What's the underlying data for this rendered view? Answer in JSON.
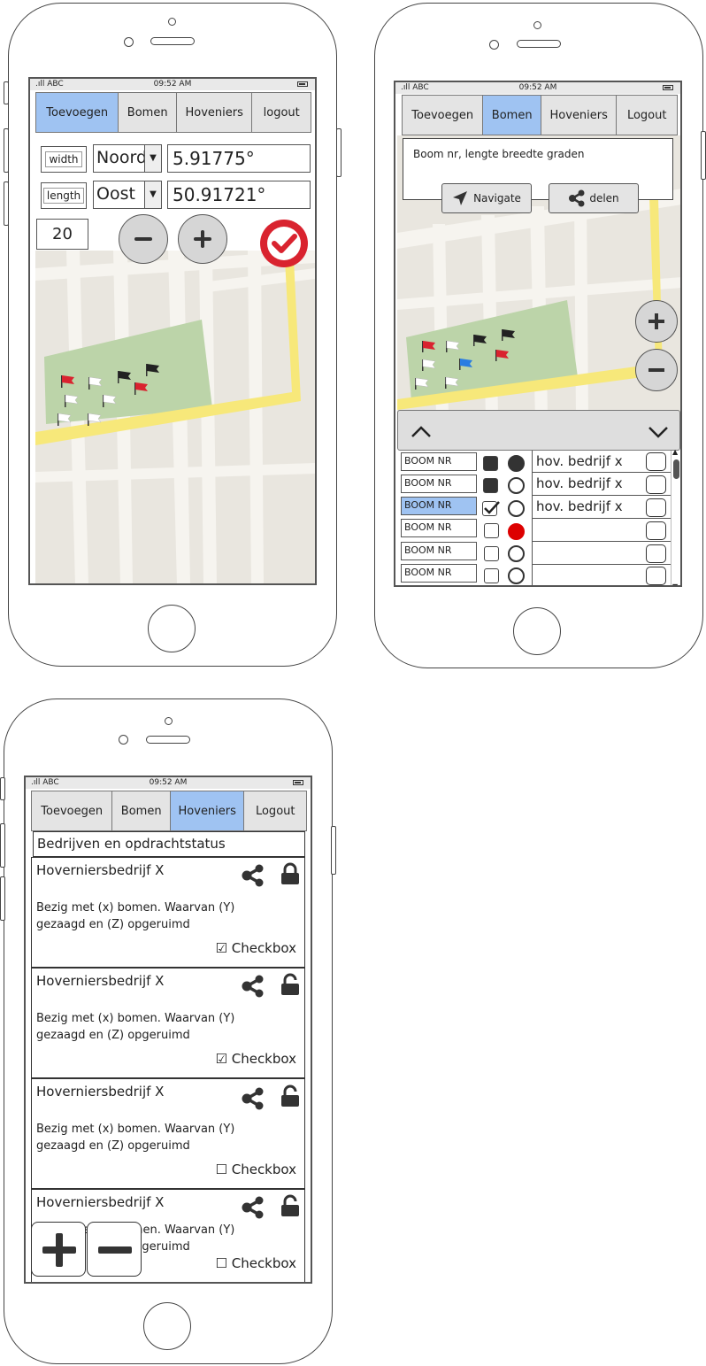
{
  "status_bar": {
    "carrier": "ABC",
    "time": "09:52 AM"
  },
  "screen1": {
    "tabs": [
      {
        "label": "Toevoegen",
        "active": true
      },
      {
        "label": "Bomen",
        "active": false
      },
      {
        "label": "Hoveniers",
        "active": false
      },
      {
        "label": "logout",
        "active": false
      }
    ],
    "width_label": "width",
    "length_label": "length",
    "direction1": "Noord",
    "direction2": "Oost",
    "value1": "5.91775°",
    "value2": "50.91721°",
    "count": "20",
    "minus_icon": "minus-icon",
    "plus_icon": "plus-icon",
    "confirm_icon": "check-circle-icon",
    "confirm_color": "#d9232f"
  },
  "screen2": {
    "tabs": [
      {
        "label": "Toevoegen",
        "active": false
      },
      {
        "label": "Bomen",
        "active": true
      },
      {
        "label": "Hoveniers",
        "active": false
      },
      {
        "label": "Logout",
        "active": false
      }
    ],
    "info_text": "Boom nr, lengte breedte graden",
    "navigate_label": "Navigate",
    "share_label": "delen",
    "rows": [
      {
        "label": "BOOM NR",
        "selected": false,
        "hov": "hov. bedrijf x"
      },
      {
        "label": "BOOM NR",
        "selected": false,
        "hov": "hov. bedrijf x"
      },
      {
        "label": "BOOM NR",
        "selected": true,
        "hov": "hov. bedrijf x"
      },
      {
        "label": "BOOM NR",
        "selected": false,
        "hov": ""
      },
      {
        "label": "BOOM NR",
        "selected": false,
        "hov": ""
      },
      {
        "label": "BOOM NR",
        "selected": false,
        "hov": ""
      }
    ]
  },
  "screen3": {
    "tabs": [
      {
        "label": "Toevoegen",
        "active": false
      },
      {
        "label": "Bomen",
        "active": false
      },
      {
        "label": "Hoveniers",
        "active": true
      },
      {
        "label": "Logout",
        "active": false
      }
    ],
    "section_title": "Bedrijven en opdrachtstatus",
    "cards": [
      {
        "title": "Hoverniersbedrijf X",
        "line1": "Bezig met (x) bomen. Waarvan (Y)",
        "line2": "gezaagd en (Z) opgeruimd",
        "check_label": "☑ Checkbox",
        "lock": "locked"
      },
      {
        "title": "Hoverniersbedrijf X",
        "line1": "Bezig met (x) bomen. Waarvan (Y)",
        "line2": "gezaagd en (Z) opgeruimd",
        "check_label": "☑ Checkbox",
        "lock": "unlocked"
      },
      {
        "title": "Hoverniersbedrijf X",
        "line1": "Bezig met (x) bomen. Waarvan (Y)",
        "line2": "gezaagd en (Z) opgeruimd",
        "check_label": "☐ Checkbox",
        "lock": "unlocked"
      },
      {
        "title": "Hoverniersbedrijf X",
        "line1": "Bezig met (x) bomen. Waarvan (Y)",
        "line2": "gezaagd en (Z) opgeruimd",
        "check_label": "☐ Checkbox",
        "lock": "unlocked"
      }
    ]
  },
  "colors": {
    "active_tab": "#9fc3f2",
    "park_green": "#bcd4a9",
    "road_yellow": "#f7e87a",
    "flag_red": "#d9232f",
    "flag_blue": "#2a7de1"
  }
}
